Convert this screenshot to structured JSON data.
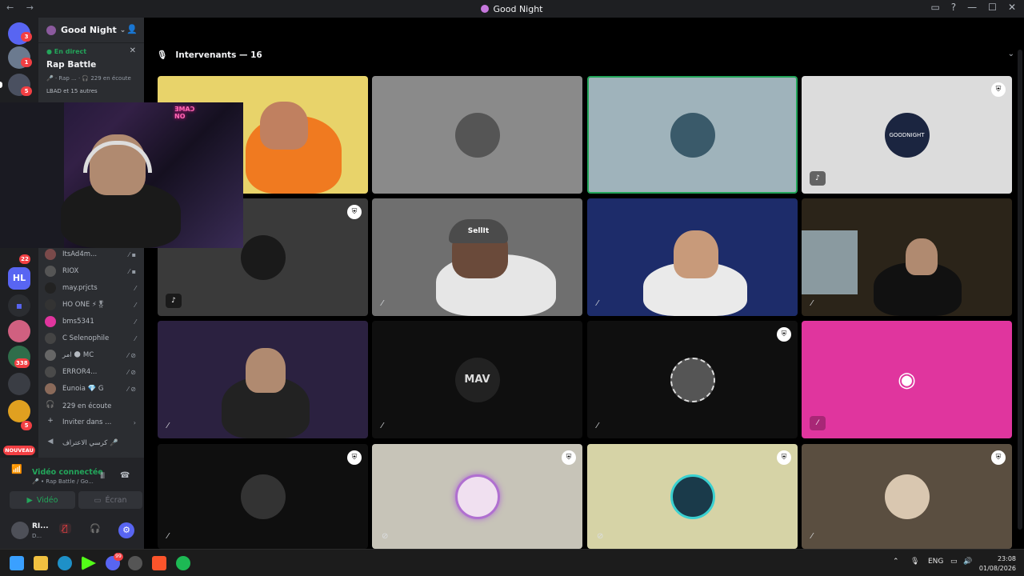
{
  "window": {
    "title": "Good Night",
    "nav": "← →",
    "controls": [
      "▭",
      "?",
      "—",
      "☐",
      "✕"
    ]
  },
  "rail": {
    "badges": [
      "3",
      "1",
      "5",
      "22",
      "338",
      "5"
    ],
    "nouveau": "NOUVEAU",
    "hl": "HL"
  },
  "server": {
    "name": "Good Night",
    "chevron": "⌄"
  },
  "live": {
    "status": "En direct",
    "title": "Rap Battle",
    "sub": "🎤 · Rap ... · 🎧 229 en écoute",
    "people": "LBAD et 15 autres"
  },
  "members": [
    {
      "name": "ItsAd4m..."
    },
    {
      "name": "RIOX"
    },
    {
      "name": "may.prjcts"
    },
    {
      "name": "HO ONE ⚡🎖"
    },
    {
      "name": "bms5341"
    },
    {
      "name": "C Selenophile"
    },
    {
      "name": "امر 🌑 MC"
    },
    {
      "name": "ERROR4..."
    },
    {
      "name": "Eunoia 💎 G"
    },
    {
      "name": "229 en écoute"
    },
    {
      "name": "Inviter dans ..."
    },
    {
      "name": "كرسي الاعتراف 🎤"
    }
  ],
  "voice": {
    "status": "Vidéo connectée",
    "channel": "🎤 • Rap Battle / Go...",
    "video_btn": "Vidéo",
    "screen_btn": "Écran"
  },
  "user": {
    "name": "RI...",
    "sub": "D..."
  },
  "main": {
    "header": "Intervenants — 16"
  },
  "tiles": [
    {
      "kind": "video",
      "bg": "#e8d36a",
      "shield": false
    },
    {
      "kind": "avatar",
      "bg": "#8a8a8a",
      "avatar": "#555",
      "shield": false
    },
    {
      "kind": "avatar",
      "bg": "#9fb3bb",
      "avatar": "#3a5a6a",
      "shield": false,
      "speaking": true
    },
    {
      "kind": "avatar",
      "bg": "#dcdcdc",
      "avatar": "#1b2540",
      "shield": true,
      "avatar_text": "GOODNIGHT"
    },
    {
      "kind": "avatar",
      "bg": "#3a3a3a",
      "avatar": "#1a1a1a",
      "shield": true
    },
    {
      "kind": "video",
      "bg": "#6f6f6f",
      "shield": false,
      "cap_text": "SellIt"
    },
    {
      "kind": "video",
      "bg": "#1d2c6a",
      "shield": false
    },
    {
      "kind": "video",
      "bg": "#2b2419",
      "shield": false
    },
    {
      "kind": "video",
      "bg": "#2b2140",
      "shield": false
    },
    {
      "kind": "avatar",
      "bg": "#0f0f0f",
      "avatar": "#222",
      "shield": false,
      "avatar_text": "MAV"
    },
    {
      "kind": "avatar",
      "bg": "#0f0f0f",
      "avatar": "#555",
      "shield": true
    },
    {
      "kind": "avatar",
      "bg": "#e0359e",
      "avatar": "#e0359e",
      "shield": false,
      "discord": true
    },
    {
      "kind": "avatar",
      "bg": "#0f0f0f",
      "avatar": "#333",
      "shield": true
    },
    {
      "kind": "avatar",
      "bg": "#c7c4b8",
      "avatar": "#b070d0",
      "shield": true
    },
    {
      "kind": "avatar",
      "bg": "#d6d3a6",
      "avatar": "#1a3a4a",
      "shield": true
    },
    {
      "kind": "avatar",
      "bg": "#5a4e40",
      "avatar": "#d9c7b0",
      "shield": true
    }
  ],
  "taskbar": {
    "lang": "ENG",
    "time": "23:08",
    "date": "01/08/2026",
    "badge": "99"
  }
}
